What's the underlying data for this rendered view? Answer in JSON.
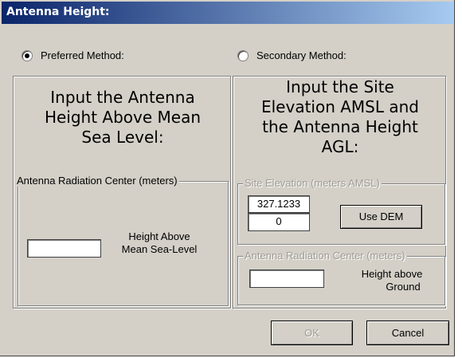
{
  "window": {
    "title": "Antenna Height:"
  },
  "methods": {
    "preferred_label": "Preferred Method:",
    "secondary_label": "Secondary Method:"
  },
  "left_panel": {
    "heading_lines": [
      "Input the Antenna",
      "Height Above Mean",
      "Sea Level:"
    ],
    "group_label": "Antenna Radiation Center (meters)",
    "height_value": "",
    "height_label_lines": [
      "Height Above",
      "Mean Sea-Level"
    ]
  },
  "right_panel": {
    "heading_lines": [
      "Input the Site",
      "Elevation AMSL and",
      "the Antenna Height",
      "AGL:"
    ],
    "site_group_label": "Site Elevation (meters AMSL)",
    "dem_elevation": "327.1233",
    "site_elevation_value": "0",
    "use_dem_label": "Use DEM",
    "antenna_group_label": "Antenna Radiation Center (meters)",
    "agl_value": "",
    "agl_label_lines": [
      "Height above",
      "Ground"
    ]
  },
  "buttons": {
    "ok_label": "OK",
    "cancel_label": "Cancel"
  }
}
